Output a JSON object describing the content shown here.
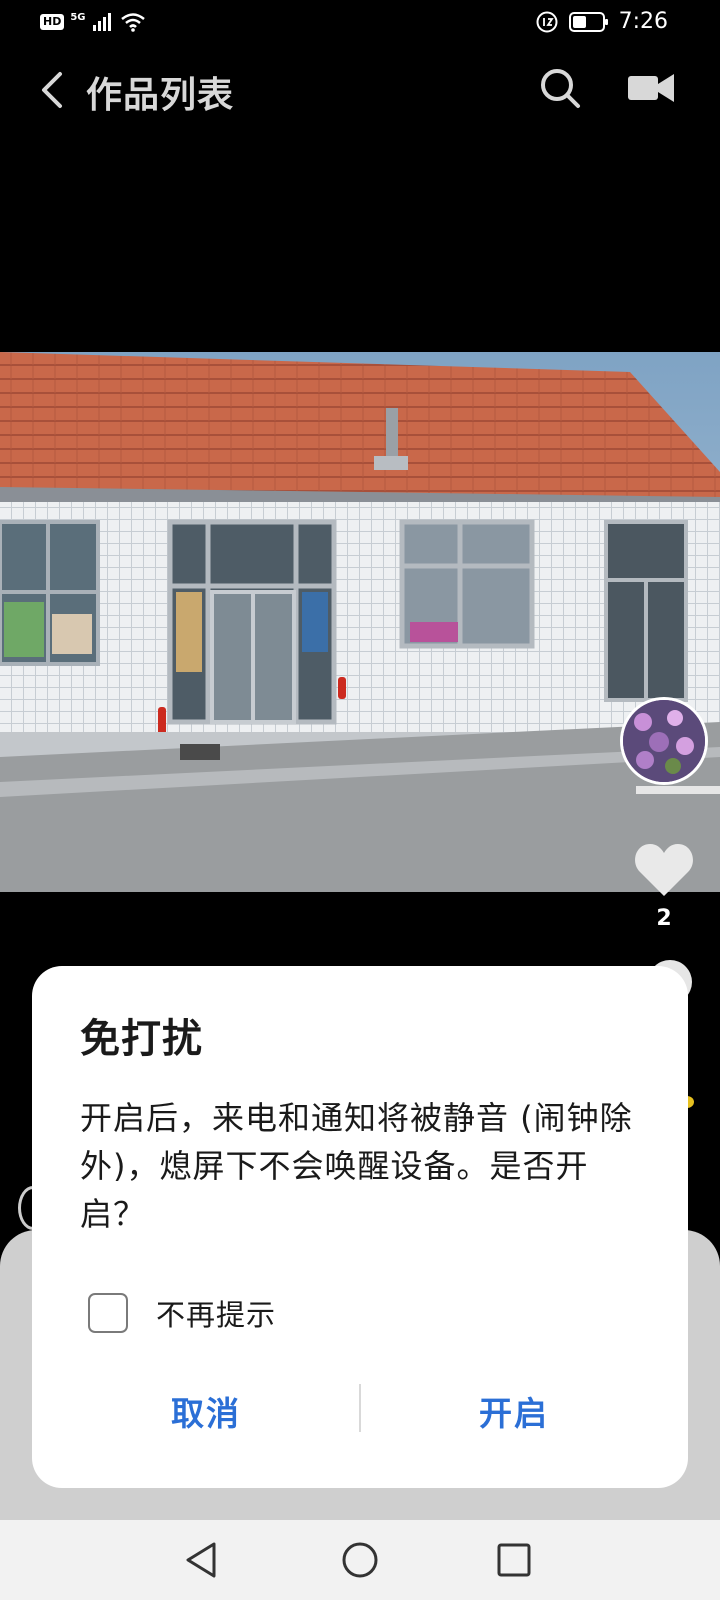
{
  "status_bar": {
    "hd_label": "HD",
    "network_label": "5G",
    "time": "7:26"
  },
  "header": {
    "title": "作品列表",
    "icons": [
      "back-arrow-icon",
      "search-icon",
      "camera-icon"
    ]
  },
  "video": {
    "description_icon": "video-frame",
    "like_count": "2"
  },
  "dialog": {
    "title": "免打扰",
    "message": "开启后，来电和通知将被静音 (闹钟除外)，熄屏下不会唤醒设备。是否开启？",
    "checkbox_label": "不再提示",
    "checkbox_checked": false,
    "cancel_label": "取消",
    "confirm_label": "开启",
    "accent_color": "#2b6fd6"
  },
  "system_nav": {
    "icons": [
      "back-triangle-icon",
      "home-circle-icon",
      "recents-square-icon"
    ]
  }
}
